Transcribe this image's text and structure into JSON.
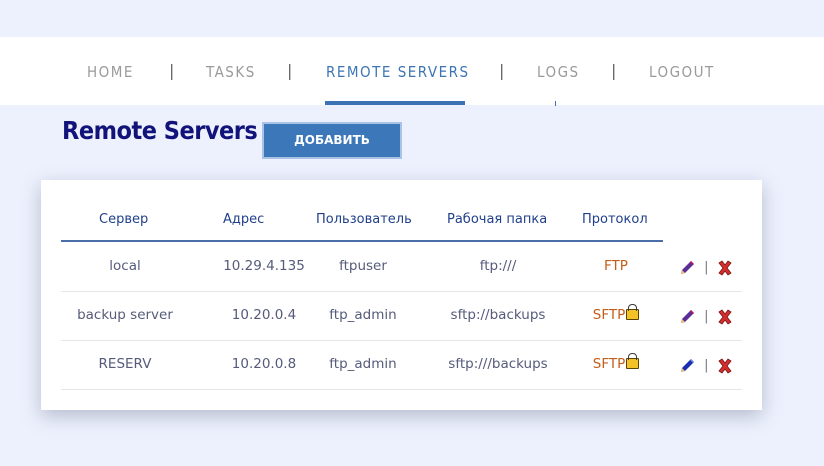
{
  "nav": {
    "items": [
      {
        "label": "HOME",
        "active": false
      },
      {
        "label": "TASKS",
        "active": false
      },
      {
        "label": "REMOTE SERVERS",
        "active": true
      },
      {
        "label": "LOGS",
        "active": false
      },
      {
        "label": "LOGOUT",
        "active": false
      }
    ],
    "separator": "|"
  },
  "page": {
    "title": "Remote Servers",
    "add_button": "ДОБАВИТЬ"
  },
  "table": {
    "headers": [
      "Сервер",
      "Адрес",
      "Пользователь",
      "Рабочая папка",
      "Протокол"
    ],
    "rows": [
      {
        "server": "local",
        "address": "10.29.4.135",
        "user": "ftpuser",
        "folder": "ftp:///",
        "protocol": "FTP",
        "secure": false
      },
      {
        "server": "backup server",
        "address": "10.20.0.4",
        "user": "ftp_admin",
        "folder": "sftp://backups",
        "protocol": "SFTP",
        "secure": true
      },
      {
        "server": "RESERV",
        "address": "10.20.0.8",
        "user": "ftp_admin",
        "folder": "sftp:///backups",
        "protocol": "SFTP",
        "secure": true
      }
    ],
    "action_separator": "|"
  },
  "colors": {
    "background": "#edf1fd",
    "accent": "#3b73b4",
    "title": "#12137a",
    "protocol": "#c45d18"
  },
  "icons": {
    "edit": "pencil-icon",
    "delete": "red-x-icon",
    "secure": "lock-icon"
  }
}
